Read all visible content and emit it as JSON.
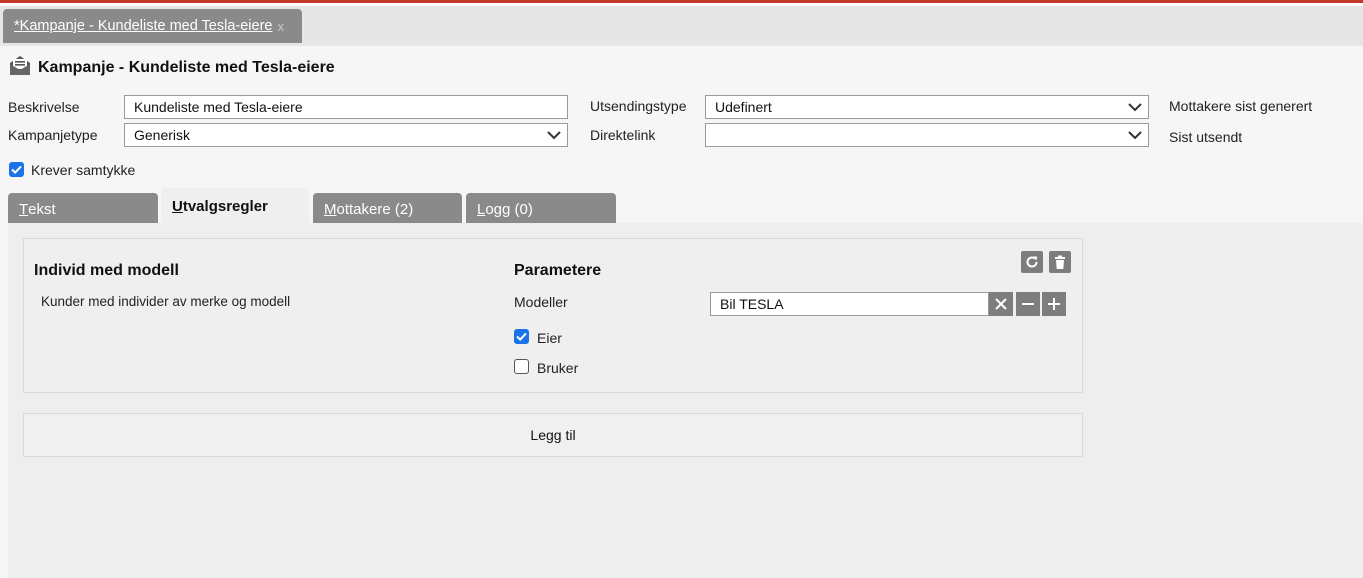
{
  "window": {
    "tab_title": "*Kampanje - Kundeliste med Tesla-eiere",
    "tab_close": "x"
  },
  "page": {
    "title": "Kampanje - Kundeliste med Tesla-eiere",
    "icon": "campaign-envelope-icon"
  },
  "form": {
    "beskrivelse_label": "Beskrivelse",
    "beskrivelse_value": "Kundeliste med Tesla-eiere",
    "kampanjetype_label": "Kampanjetype",
    "kampanjetype_value": "Generisk",
    "utsendingstype_label": "Utsendingstype",
    "utsendingstype_value": "Udefinert",
    "direktelink_label": "Direktelink",
    "direktelink_value": "",
    "mottakere_generert_label": "Mottakere sist generert",
    "sist_utsendt_label": "Sist utsendt",
    "krever_samtykke_label": "Krever samtykke",
    "krever_samtykke_checked": true
  },
  "tabs": [
    {
      "label": "Tekst",
      "underline": "T",
      "rest": "ekst",
      "active": false
    },
    {
      "label": "Utvalgsregler",
      "underline": "U",
      "rest": "tvalgsregler",
      "active": true
    },
    {
      "label": "Mottakere (2)",
      "underline": "M",
      "rest": "ottakere (2)",
      "active": false
    },
    {
      "label": "Logg (0)",
      "underline": "L",
      "rest": "ogg (0)",
      "active": false
    }
  ],
  "rule": {
    "title": "Individ med modell",
    "description": "Kunder med individer av merke og modell",
    "params_title": "Parametere",
    "modeller_label": "Modeller",
    "modeller_value": "Bil TESLA",
    "eier_label": "Eier",
    "eier_checked": true,
    "bruker_label": "Bruker",
    "bruker_checked": false
  },
  "add_label": "Legg til",
  "colors": {
    "accent": "#c0392b",
    "tab_inactive": "#8a8a8a",
    "checkbox": "#1a73e8",
    "icon_button": "#7d7d7d"
  }
}
